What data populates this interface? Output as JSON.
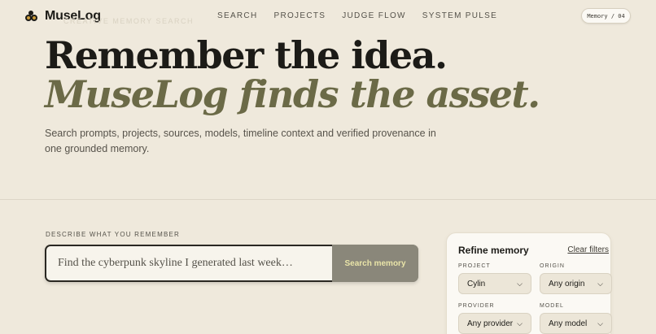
{
  "app": {
    "name": "MuseLog",
    "ghost_label": "CREATIVE MEMORY SEARCH"
  },
  "nav": [
    {
      "label": "SEARCH"
    },
    {
      "label": "PROJECTS"
    },
    {
      "label": "JUDGE FLOW"
    },
    {
      "label": "SYSTEM PULSE"
    }
  ],
  "memory_pill": "Memory / 04",
  "hero": {
    "title_plain": "Remember the idea. ",
    "title_accent": "MuseLog finds the asset.",
    "subtitle": "Search prompts, projects, sources, models, timeline context and verified provenance in one grounded memory."
  },
  "search": {
    "label": "DESCRIBE WHAT YOU REMEMBER",
    "placeholder": "Find the cyberpunk skyline I generated last week…",
    "value": "",
    "button": "Search memory"
  },
  "refine": {
    "title": "Refine memory",
    "clear": "Clear filters",
    "fields": [
      {
        "label": "PROJECT",
        "value": "Cylin"
      },
      {
        "label": "ORIGIN",
        "value": "Any origin"
      },
      {
        "label": "PROVIDER",
        "value": "Any provider"
      },
      {
        "label": "MODEL",
        "value": "Any model"
      }
    ]
  },
  "colors": {
    "background": "#efe9dc",
    "accent": "#6b6a47",
    "button": "#8a877a",
    "button_text": "#e9e4a8"
  },
  "icons": {
    "logo": "muselog-logo-icon",
    "chevron": "chevron-down-icon"
  }
}
